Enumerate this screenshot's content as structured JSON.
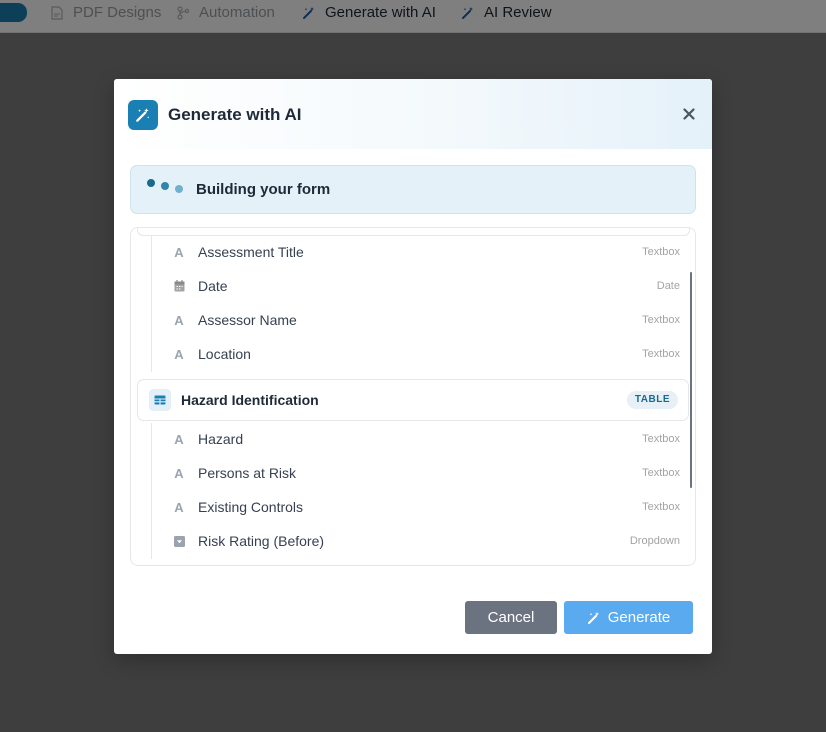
{
  "nav": {
    "tabs": [
      {
        "label": "PDF Designs",
        "icon": "pdf-icon"
      },
      {
        "label": "Automation",
        "icon": "flow-icon"
      },
      {
        "label": "Generate with AI",
        "icon": "magic-wand-icon"
      },
      {
        "label": "AI Review",
        "icon": "magic-wand-icon"
      }
    ]
  },
  "modal": {
    "title": "Generate with AI",
    "close_icon": "close-icon",
    "status": {
      "text": "Building your form"
    },
    "fields": [
      {
        "name": "Assessment Title",
        "type": "Textbox",
        "icon": "text-icon"
      },
      {
        "name": "Date",
        "type": "Date",
        "icon": "calendar-icon"
      },
      {
        "name": "Assessor Name",
        "type": "Textbox",
        "icon": "text-icon"
      },
      {
        "name": "Location",
        "type": "Textbox",
        "icon": "text-icon"
      }
    ],
    "section": {
      "title": "Hazard Identification",
      "badge": "TABLE",
      "icon": "table-icon"
    },
    "section_fields": [
      {
        "name": "Hazard",
        "type": "Textbox",
        "icon": "text-icon"
      },
      {
        "name": "Persons at Risk",
        "type": "Textbox",
        "icon": "text-icon"
      },
      {
        "name": "Existing Controls",
        "type": "Textbox",
        "icon": "text-icon"
      },
      {
        "name": "Risk Rating (Before)",
        "type": "Dropdown",
        "icon": "dropdown-icon"
      }
    ],
    "buttons": {
      "cancel": "Cancel",
      "generate": "Generate"
    }
  },
  "colors": {
    "accent": "#1a7fb3",
    "generate_button": "#5aaaf0",
    "cancel_button": "#6b7280",
    "status_bg": "#e5f1f8"
  }
}
